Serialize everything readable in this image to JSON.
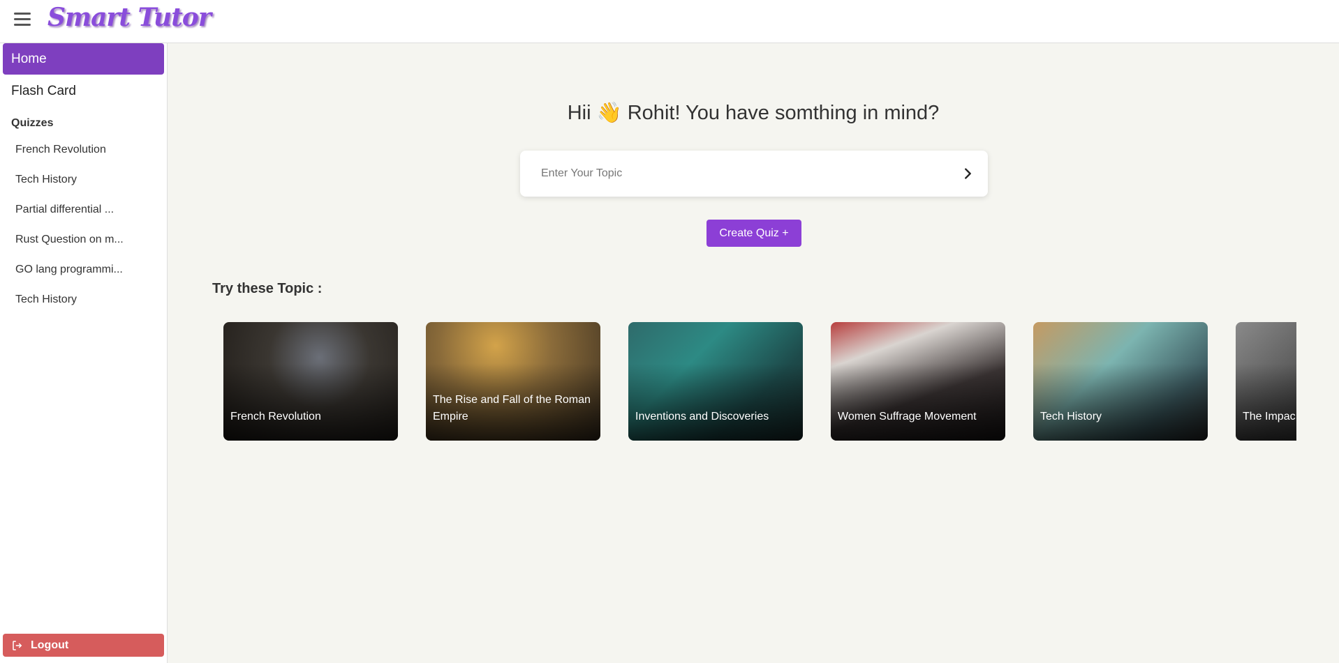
{
  "header": {
    "logo_text": "Smart Tutor"
  },
  "sidebar": {
    "home_label": "Home",
    "flashcard_label": "Flash Card",
    "quizzes_heading": "Quizzes",
    "quizzes": [
      {
        "label": "French Revolution"
      },
      {
        "label": "Tech History"
      },
      {
        "label": "Partial differential ..."
      },
      {
        "label": "Rust Question on m..."
      },
      {
        "label": "GO lang programmi..."
      },
      {
        "label": "Tech History"
      }
    ],
    "logout_label": "Logout"
  },
  "main": {
    "greeting": "Hii 👋 Rohit! You have somthing in mind?",
    "search_placeholder": "Enter Your Topic",
    "create_quiz_label": "Create Quiz +",
    "try_heading": "Try these Topic :",
    "topics": [
      {
        "title": "French Revolution"
      },
      {
        "title": "The Rise and Fall of the Roman Empire"
      },
      {
        "title": "Inventions and Discoveries"
      },
      {
        "title": "Women Suffrage Movement"
      },
      {
        "title": "Tech History"
      },
      {
        "title": "The Impac Revolution"
      }
    ]
  },
  "colors": {
    "accent": "#7e3fbf",
    "button": "#8c3fd6",
    "logout": "#d65c5c",
    "background": "#f5f5f0"
  }
}
